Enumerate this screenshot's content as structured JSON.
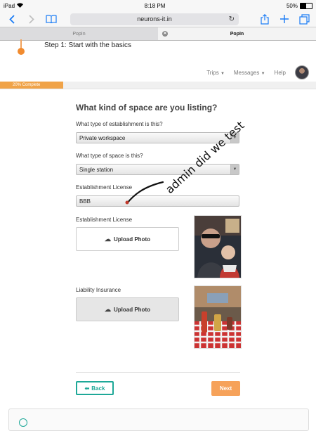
{
  "status_bar": {
    "device": "iPad",
    "time": "8:18 PM",
    "battery": "50%"
  },
  "browser": {
    "url": "neurons-it.in",
    "tabs": [
      {
        "label": "PopIn",
        "active": false
      },
      {
        "label": "PopIn",
        "active": true
      }
    ]
  },
  "page": {
    "step_title": "Step 1: Start with the basics",
    "nav": {
      "trips": "Trips",
      "messages": "Messages",
      "help": "Help"
    },
    "progress": {
      "label": "20% Complete",
      "value": 0.2
    },
    "heading": "What kind of space are you listing?",
    "establishment_type": {
      "label": "What type of establishment is this?",
      "value": "Private workspace"
    },
    "space_type": {
      "label": "What type of space is this?",
      "value": "Single station"
    },
    "establishment_license": {
      "label": "Establishment License",
      "value": "BBB"
    },
    "establishment_license_photo": {
      "label": "Establishment License",
      "button": "Upload Photo"
    },
    "liability_insurance": {
      "label": "Liability Insurance",
      "button": "Upload Photo"
    },
    "back_label": "Back",
    "next_label": "Next"
  },
  "handwriting": "admin did we test",
  "colors": {
    "accent_orange": "#f0a348",
    "accent_teal": "#1ea898",
    "ios_blue": "#1a7cf5"
  }
}
